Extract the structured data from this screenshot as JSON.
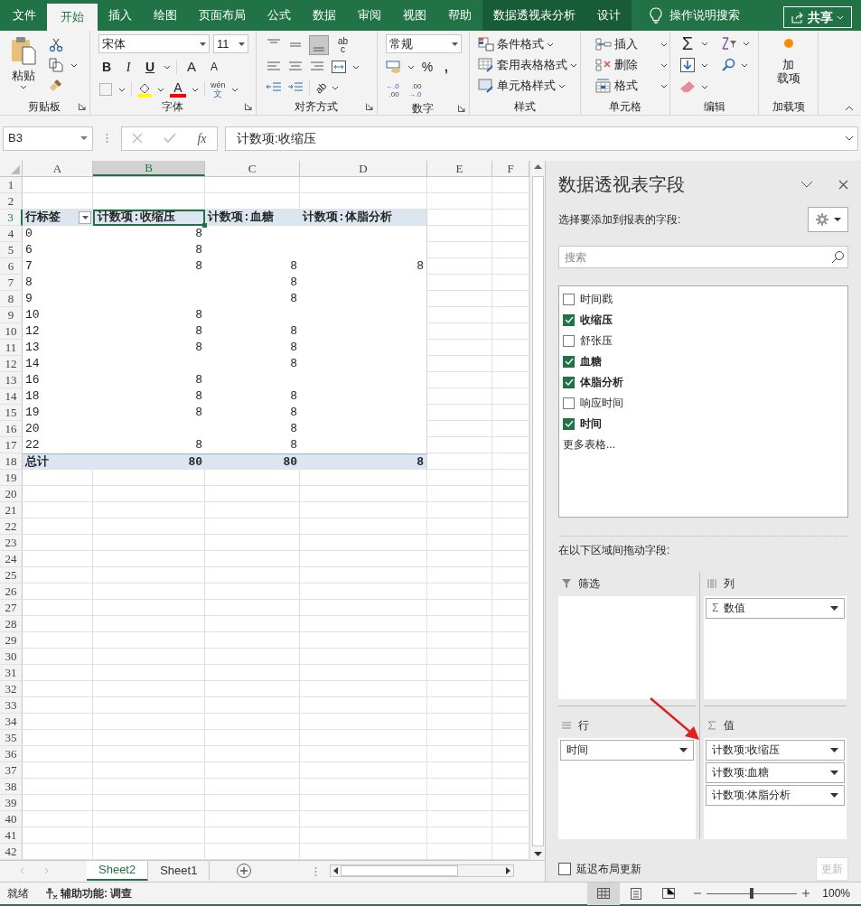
{
  "tabs": [
    {
      "label": "文件",
      "kind": "normal",
      "selected": false
    },
    {
      "label": "开始",
      "kind": "normal",
      "selected": true
    },
    {
      "label": "插入",
      "kind": "normal",
      "selected": false
    },
    {
      "label": "绘图",
      "kind": "normal",
      "selected": false
    },
    {
      "label": "页面布局",
      "kind": "normal",
      "selected": false
    },
    {
      "label": "公式",
      "kind": "normal",
      "selected": false
    },
    {
      "label": "数据",
      "kind": "normal",
      "selected": false
    },
    {
      "label": "审阅",
      "kind": "normal",
      "selected": false
    },
    {
      "label": "视图",
      "kind": "normal",
      "selected": false
    },
    {
      "label": "帮助",
      "kind": "normal",
      "selected": false
    },
    {
      "label": "数据透视表分析",
      "kind": "contextual",
      "selected": false
    },
    {
      "label": "设计",
      "kind": "contextual",
      "selected": false
    }
  ],
  "tell_me": "操作说明搜索",
  "share": "共享",
  "ribbon": {
    "groups": [
      {
        "label": "剪贴板",
        "paste": "粘贴"
      },
      {
        "label": "字体",
        "font_name": "宋体",
        "font_size": "11",
        "bold": "B",
        "italic": "I",
        "underline": "U",
        "grow": "A",
        "shrink": "A",
        "font_color": "A",
        "phonetic_top": "wén",
        "phonetic_bottom": "文"
      },
      {
        "label": "对齐方式",
        "wrap_top": "ab",
        "wrap_bottom": "c",
        "orientation": "ab"
      },
      {
        "label": "数字",
        "format": "常规",
        "percent": "%",
        "comma": ",",
        "increase_decimal": [
          "←.0",
          ".00"
        ],
        "decrease_decimal": [
          ".00",
          "→.0"
        ]
      },
      {
        "label": "样式",
        "items": [
          "条件格式",
          "套用表格格式",
          "单元格样式"
        ]
      },
      {
        "label": "单元格",
        "items": [
          "插入",
          "删除",
          "格式"
        ]
      },
      {
        "label": "编辑",
        "autosum": "Σ"
      },
      {
        "label": "加载项",
        "button": [
          "加",
          "载项"
        ]
      }
    ]
  },
  "formula_bar": {
    "name_box": "B3",
    "fx": "fx",
    "formula": "计数项:收缩压"
  },
  "sheet": {
    "columns": [
      {
        "label": "A",
        "selected": false
      },
      {
        "label": "B",
        "selected": true
      },
      {
        "label": "C",
        "selected": false
      },
      {
        "label": "D",
        "selected": false
      },
      {
        "label": "E",
        "selected": false
      },
      {
        "label": "F",
        "selected": false
      }
    ],
    "rows": [
      {
        "number": "1",
        "kind": "blank",
        "selected": false
      },
      {
        "number": "2",
        "kind": "blank",
        "selected": false
      },
      {
        "number": "3",
        "kind": "header",
        "selected": true,
        "label": "行标签",
        "column_b": "计数项:收缩压",
        "column_c": "计数项:血糖",
        "column_d": "计数项:体脂分析"
      },
      {
        "number": "4",
        "kind": "data",
        "selected": false,
        "label": "0",
        "column_b": "8"
      },
      {
        "number": "5",
        "kind": "data",
        "selected": false,
        "label": "6",
        "column_b": "8"
      },
      {
        "number": "6",
        "kind": "data",
        "selected": false,
        "label": "7",
        "column_b": "8",
        "column_c": "8",
        "column_d": "8"
      },
      {
        "number": "7",
        "kind": "data",
        "selected": false,
        "label": "8",
        "column_c": "8"
      },
      {
        "number": "8",
        "kind": "data",
        "selected": false,
        "label": "9",
        "column_c": "8"
      },
      {
        "number": "9",
        "kind": "data",
        "selected": false,
        "label": "10",
        "column_b": "8"
      },
      {
        "number": "10",
        "kind": "data",
        "selected": false,
        "label": "12",
        "column_b": "8",
        "column_c": "8"
      },
      {
        "number": "11",
        "kind": "data",
        "selected": false,
        "label": "13",
        "column_b": "8",
        "column_c": "8"
      },
      {
        "number": "12",
        "kind": "data",
        "selected": false,
        "label": "14",
        "column_c": "8"
      },
      {
        "number": "13",
        "kind": "data",
        "selected": false,
        "label": "16",
        "column_b": "8"
      },
      {
        "number": "14",
        "kind": "data",
        "selected": false,
        "label": "18",
        "column_b": "8",
        "column_c": "8"
      },
      {
        "number": "15",
        "kind": "data",
        "selected": false,
        "label": "19",
        "column_b": "8",
        "column_c": "8"
      },
      {
        "number": "16",
        "kind": "data",
        "selected": false,
        "label": "20",
        "column_c": "8"
      },
      {
        "number": "17",
        "kind": "data",
        "selected": false,
        "label": "22",
        "column_b": "8",
        "column_c": "8"
      },
      {
        "number": "18",
        "kind": "total",
        "selected": false,
        "label": "总计",
        "column_b": "80",
        "column_c": "80",
        "column_d": "8"
      },
      {
        "number": "19",
        "kind": "blank",
        "selected": false
      },
      {
        "number": "20",
        "kind": "blank",
        "selected": false
      },
      {
        "number": "21",
        "kind": "blank",
        "selected": false
      },
      {
        "number": "22",
        "kind": "blank",
        "selected": false
      },
      {
        "number": "23",
        "kind": "blank",
        "selected": false
      },
      {
        "number": "24",
        "kind": "blank",
        "selected": false
      },
      {
        "number": "25",
        "kind": "blank",
        "selected": false
      },
      {
        "number": "26",
        "kind": "blank",
        "selected": false
      },
      {
        "number": "27",
        "kind": "blank",
        "selected": false
      },
      {
        "number": "28",
        "kind": "blank",
        "selected": false
      },
      {
        "number": "29",
        "kind": "blank",
        "selected": false
      },
      {
        "number": "30",
        "kind": "blank",
        "selected": false
      },
      {
        "number": "31",
        "kind": "blank",
        "selected": false
      },
      {
        "number": "32",
        "kind": "blank",
        "selected": false
      },
      {
        "number": "33",
        "kind": "blank",
        "selected": false
      },
      {
        "number": "34",
        "kind": "blank",
        "selected": false
      },
      {
        "number": "35",
        "kind": "blank",
        "selected": false
      },
      {
        "number": "36",
        "kind": "blank",
        "selected": false
      },
      {
        "number": "37",
        "kind": "blank",
        "selected": false
      },
      {
        "number": "38",
        "kind": "blank",
        "selected": false
      },
      {
        "number": "39",
        "kind": "blank",
        "selected": false
      },
      {
        "number": "40",
        "kind": "blank",
        "selected": false
      },
      {
        "number": "41",
        "kind": "blank",
        "selected": false
      },
      {
        "number": "42",
        "kind": "blank",
        "selected": false
      }
    ]
  },
  "sheet_tabs": [
    {
      "label": "Sheet2",
      "selected": true
    },
    {
      "label": "Sheet1",
      "selected": false
    }
  ],
  "pivot_panel": {
    "title": "数据透视表字段",
    "subtitle": "选择要添加到报表的字段:",
    "search_placeholder": "搜索",
    "fields": [
      {
        "label": "时间戳",
        "checked": false
      },
      {
        "label": "收缩压",
        "checked": true
      },
      {
        "label": "舒张压",
        "checked": false
      },
      {
        "label": "血糖",
        "checked": true
      },
      {
        "label": "体脂分析",
        "checked": true
      },
      {
        "label": "响应时间",
        "checked": false
      },
      {
        "label": "时间",
        "checked": true
      }
    ],
    "more_tables": "更多表格...",
    "drag_hint": "在以下区域间拖动字段:",
    "filters": {
      "label": "筛选"
    },
    "columns": {
      "label": "列",
      "items": [
        {
          "sigma": "Σ",
          "label": "数值"
        }
      ]
    },
    "rows": {
      "label": "行",
      "items": [
        {
          "label": "时间"
        }
      ]
    },
    "values": {
      "label": "值",
      "items": [
        {
          "label": "计数项:收缩压"
        },
        {
          "label": "计数项:血糖"
        },
        {
          "label": "计数项:体脂分析"
        }
      ]
    },
    "defer_update": {
      "label": "延迟布局更新",
      "checked": false
    },
    "update_button": {
      "label": "更新",
      "disabled": true
    }
  },
  "status_bar": {
    "ready": "就绪",
    "accessibility": "辅助功能: 调查",
    "views": [
      {
        "kind": "normal",
        "selected": true
      },
      {
        "kind": "page_layout",
        "selected": false
      },
      {
        "kind": "page_break",
        "selected": false
      }
    ],
    "zoom_slider": {
      "level": 0.5
    },
    "zoom": "100%"
  }
}
